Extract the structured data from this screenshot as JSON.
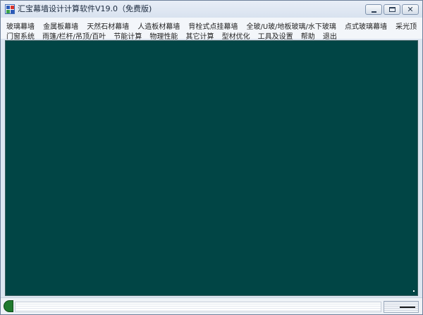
{
  "window": {
    "title": "汇宝幕墙设计计算软件V19.0（免费版)",
    "controls": {
      "minimize_icon": "minimize-icon",
      "maximize_icon": "maximize-icon",
      "close_icon": "close-icon",
      "close_glyph": "✕"
    }
  },
  "menu": {
    "row1": [
      "玻璃幕墙",
      "金属板幕墙",
      "天然石材幕墙",
      "人造板材幕墙",
      "背栓式点挂幕墙",
      "全玻/U玻/地板玻璃/水下玻璃",
      "点式玻璃幕墙",
      "采光顶"
    ],
    "row2": [
      "门窗系统",
      "雨篷/栏杆/吊顶/百叶",
      "节能计算",
      "物理性能",
      "其它计算",
      "型材优化",
      "工具及设置",
      "帮助",
      "退出"
    ]
  },
  "colors": {
    "workspace_bg": "#014545",
    "status_indicator": "#1f7a2e"
  }
}
